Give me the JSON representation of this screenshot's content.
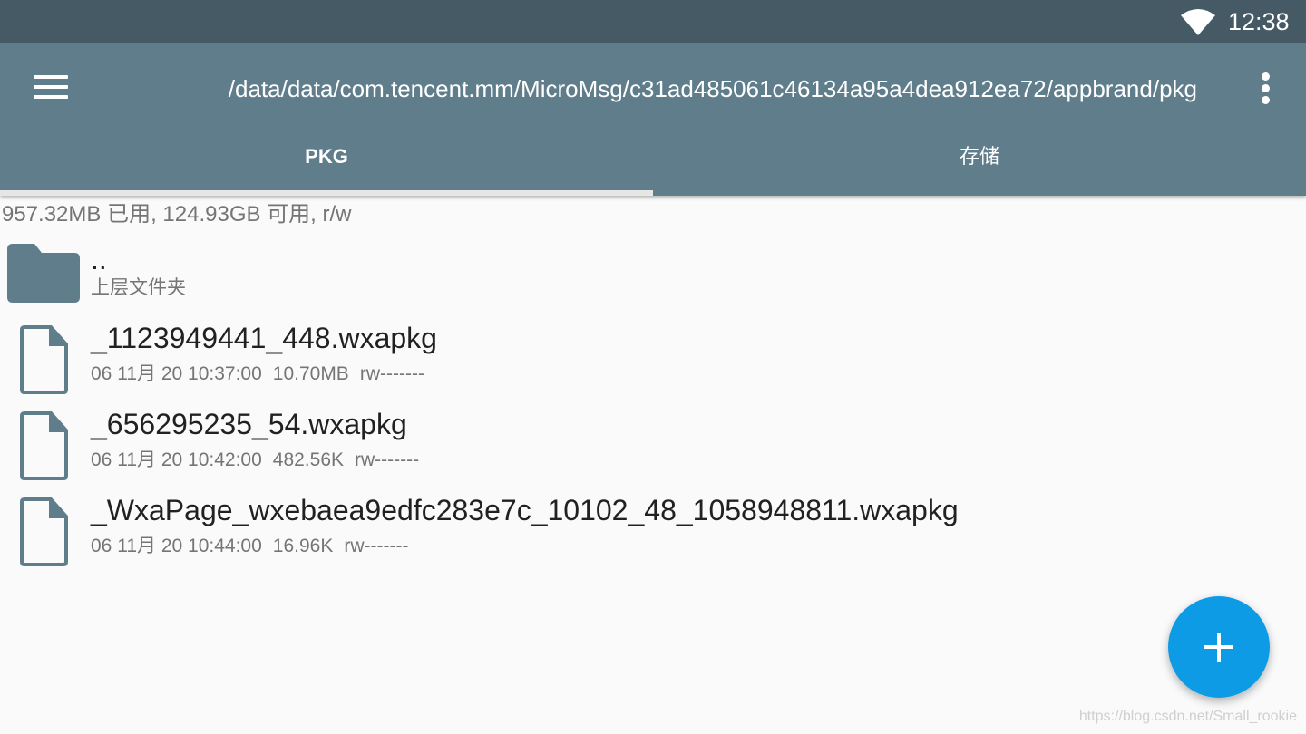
{
  "status_bar": {
    "time": "12:38",
    "icons": [
      "wifi-icon"
    ]
  },
  "toolbar": {
    "path": "/data/data/com.tencent.mm/MicroMsg/c31ad485061c46134a95a4dea912ea72/appbrand/pkg",
    "icons": [
      "menu-icon",
      "more-vert-icon"
    ]
  },
  "tabs": [
    {
      "label": "PKG",
      "active": true
    },
    {
      "label": "存储",
      "active": false
    }
  ],
  "storage": {
    "usage": "957.32MB 已用, 124.93GB 可用, r/w"
  },
  "parent": {
    "name": "..",
    "subtitle": "上层文件夹",
    "icon": "folder-icon"
  },
  "files": [
    {
      "name": "_1123949441_448.wxapkg",
      "date": "06 11月 20 10:37:00",
      "size": "10.70MB",
      "perms": "rw-------",
      "icon": "file-icon"
    },
    {
      "name": "_656295235_54.wxapkg",
      "date": "06 11月 20 10:42:00",
      "size": "482.56K",
      "perms": "rw-------",
      "icon": "file-icon"
    },
    {
      "name": "_WxaPage_wxebaea9edfc283e7c_10102_48_1058948811.wxapkg",
      "date": "06 11月 20 10:44:00",
      "size": "16.96K",
      "perms": "rw-------",
      "icon": "file-icon"
    }
  ],
  "fab": {
    "icon": "plus-icon",
    "color": "#0d9be6"
  },
  "colors": {
    "status_bar": "#455a64",
    "toolbar": "#607d8b",
    "icon": "#607d8b",
    "fab": "#0d9be6"
  },
  "watermark": "https://blog.csdn.net/Small_rookie"
}
